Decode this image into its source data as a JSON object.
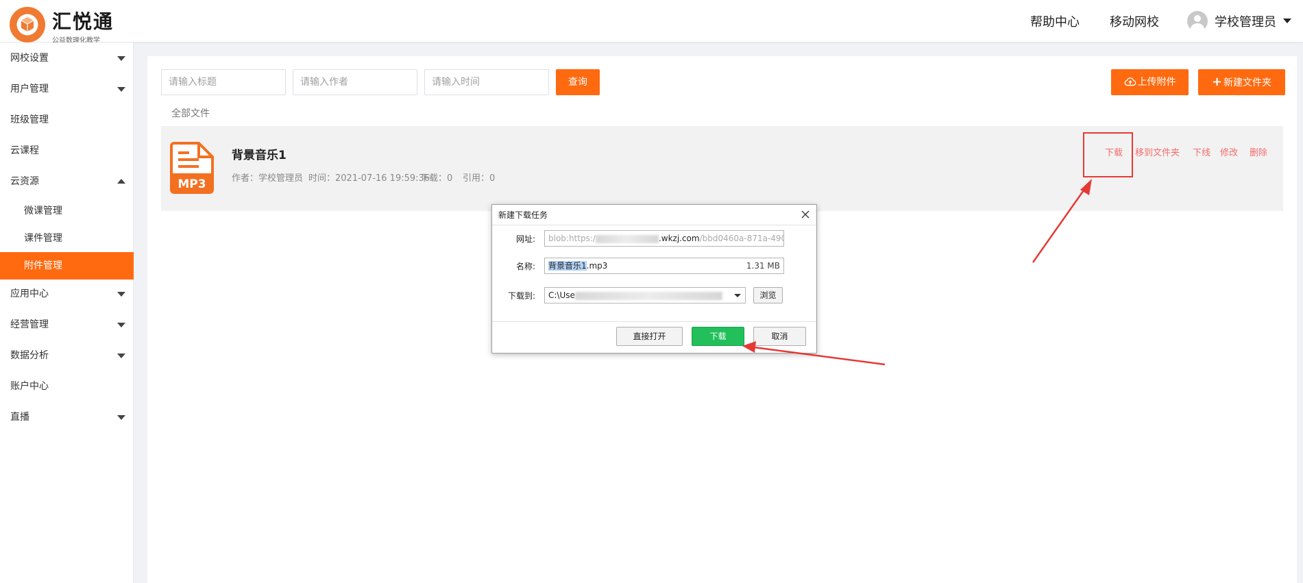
{
  "header": {
    "logo_title": "汇悦通",
    "logo_subtitle": "公益数理化教学",
    "nav_help": "帮助中心",
    "nav_mobile": "移动网校",
    "user_name": "学校管理员"
  },
  "sidebar": {
    "items": [
      {
        "label": "网校设置",
        "caret": "down"
      },
      {
        "label": "用户管理",
        "caret": "down"
      },
      {
        "label": "班级管理"
      },
      {
        "label": "云课程"
      },
      {
        "label": "云资源",
        "caret": "up"
      },
      {
        "label": "微课管理",
        "sub": true
      },
      {
        "label": "课件管理",
        "sub": true
      },
      {
        "label": "附件管理",
        "sub": true,
        "active": true
      },
      {
        "label": "应用中心",
        "caret": "down"
      },
      {
        "label": "经营管理",
        "caret": "down"
      },
      {
        "label": "数据分析",
        "caret": "down"
      },
      {
        "label": "账户中心"
      },
      {
        "label": "直播",
        "caret": "down"
      }
    ]
  },
  "filters": {
    "title_placeholder": "请输入标题",
    "author_placeholder": "请输入作者",
    "time_placeholder": "请输入时间",
    "query_label": "查询"
  },
  "toolbar": {
    "upload_label": "上传附件",
    "new_folder_label": "新建文件夹"
  },
  "breadcrumb": "全部文件",
  "file": {
    "title": "背景音乐1",
    "icon_text": "MP3",
    "author": "作者：学校管理员",
    "time": "时间：2021-07-16 19:59:36",
    "downloads": "下载：0",
    "references": "引用：0",
    "actions": [
      "下载",
      "移到文件夹",
      "下线",
      "修改",
      "删除"
    ]
  },
  "dialog": {
    "title": "新建下载任务",
    "url_label": "网址:",
    "url_prefix": "blob:https:/",
    "url_domain": ".wkzj.com",
    "url_suffix": "/bbd0460a-871a-490",
    "name_label": "名称:",
    "name_selected": "背景音乐1",
    "name_ext": ".mp3",
    "size": "1.31 MB",
    "save_label": "下载到:",
    "save_path": "C:\\Use",
    "browse_label": "浏览",
    "open_label": "直接打开",
    "download_label": "下载",
    "cancel_label": "取消"
  },
  "colors": {
    "accent": "#ff6a10",
    "action_red": "#f56c6c",
    "annotation_red": "#e53935",
    "download_green": "#22bf5b"
  }
}
